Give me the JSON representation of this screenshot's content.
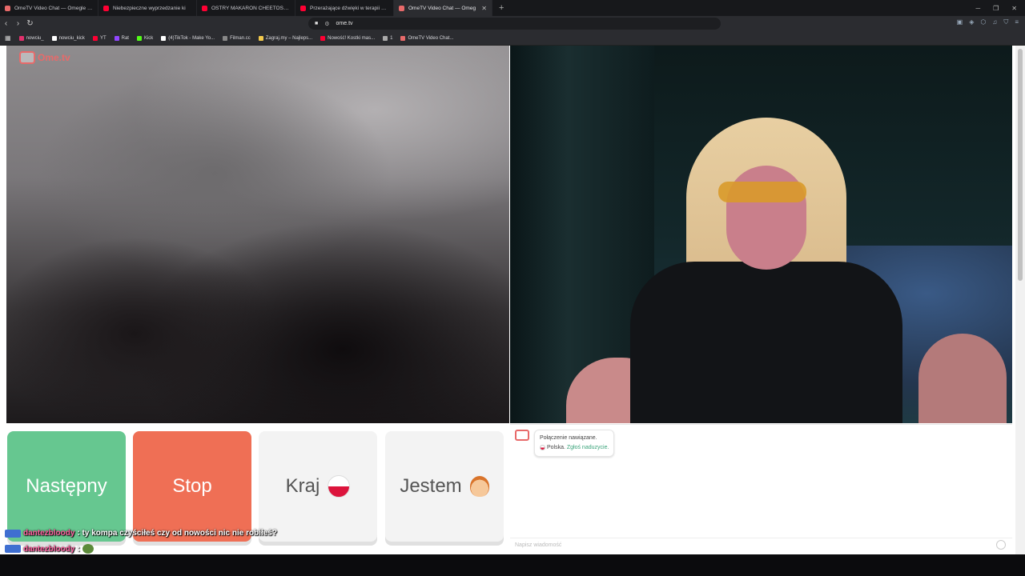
{
  "tabs": [
    {
      "title": "OmeTV Video Chat — Omegle Rand",
      "color": "#e86a6a",
      "active": false
    },
    {
      "title": "Niebezpieczne wyprzedzanie ki",
      "color": "#ff0033",
      "active": false
    },
    {
      "title": "OSTRY MAKARON CHEETOS - TEST",
      "color": "#ff0033",
      "active": false
    },
    {
      "title": "Przerażające dźwięki w terapii manu",
      "color": "#ff0033",
      "active": false
    },
    {
      "title": "OmeTV Video Chat — Omeg",
      "color": "#e86a6a",
      "active": true
    }
  ],
  "url": "ome.tv",
  "bookmarks": [
    {
      "label": "nowciu_",
      "color": "#e1306c"
    },
    {
      "label": "nowciu_kick",
      "color": "#ffffff"
    },
    {
      "label": "YT",
      "color": "#ff0033"
    },
    {
      "label": "Rat",
      "color": "#9146ff"
    },
    {
      "label": "Kick",
      "color": "#53fc18"
    },
    {
      "label": "(4)TikTok - Make Yo...",
      "color": "#ffffff"
    },
    {
      "label": "Filman.cc",
      "color": "#888888"
    },
    {
      "label": "Zagraj.my – Najleps...",
      "color": "#f2c94c"
    },
    {
      "label": "Nowość! Kostki mas...",
      "color": "#ff0033"
    },
    {
      "label": "1",
      "color": "#aaaaaa"
    },
    {
      "label": "OmeTV Video Chat...",
      "color": "#e86a6a"
    }
  ],
  "logo": "Ome.tv",
  "buttons": {
    "next": "Następny",
    "stop": "Stop",
    "country": "Kraj",
    "gender": "Jestem"
  },
  "chat": {
    "system_line1": "Połączenie nawiązane.",
    "country": "Polska.",
    "report_link": "Zgłoś naduzycie.",
    "input_placeholder": "Napisz wiadomość"
  },
  "stream_chat": [
    {
      "user": "dantezbloody",
      "message": ": ty kompa czyściłeś czy od nowości nic nie robiłeś?"
    },
    {
      "user": "dantezbloody",
      "message": ":"
    }
  ],
  "colors": {
    "next": "#66c790",
    "stop": "#ef6f55",
    "accent": "#e86a6a",
    "link": "#3aa37a"
  }
}
